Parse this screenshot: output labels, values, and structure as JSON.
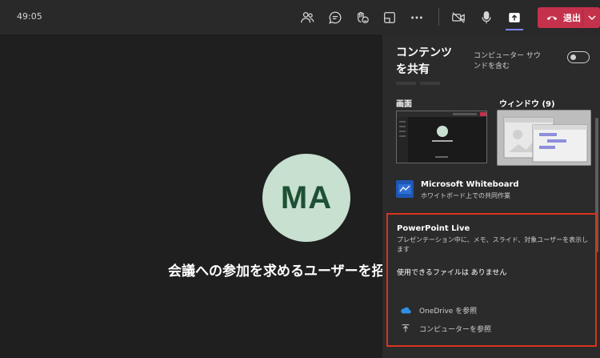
{
  "meeting": {
    "timer": "49:05",
    "leave_label": "退出"
  },
  "toolbar": {
    "icons": [
      "people-icon",
      "chat-icon",
      "reactions-icon",
      "rooms-icon",
      "more-icon",
      "camera-off-icon",
      "mic-icon",
      "share-icon"
    ]
  },
  "stage": {
    "avatar_initials": "MA",
    "invite_text": "会議への参加を求めるユーザーを招"
  },
  "share_panel": {
    "title": "コンテンツを共有",
    "computer_sound_label": "コンピューター サウンドを含む",
    "computer_sound_on": false,
    "screen_label": "画面",
    "window_label": "ウィンドウ (9)",
    "whiteboard": {
      "title": "Microsoft Whiteboard",
      "subtitle": "ホワイトボード上での共同作業"
    },
    "powerpoint_live": {
      "title": "PowerPoint Live",
      "description": "プレゼンテーション中に、メモ、スライド、対象ユーザーを表示します",
      "no_files": "使用できるファイルは ありません",
      "onedrive_label": "OneDrive を参照",
      "computer_label": "コンピューターを参照"
    }
  },
  "colors": {
    "leave": "#c4314b",
    "accent": "#7f85f5",
    "highlight_border": "#d9341e",
    "avatar_bg": "#c7e0d0",
    "avatar_text": "#1e5133"
  }
}
